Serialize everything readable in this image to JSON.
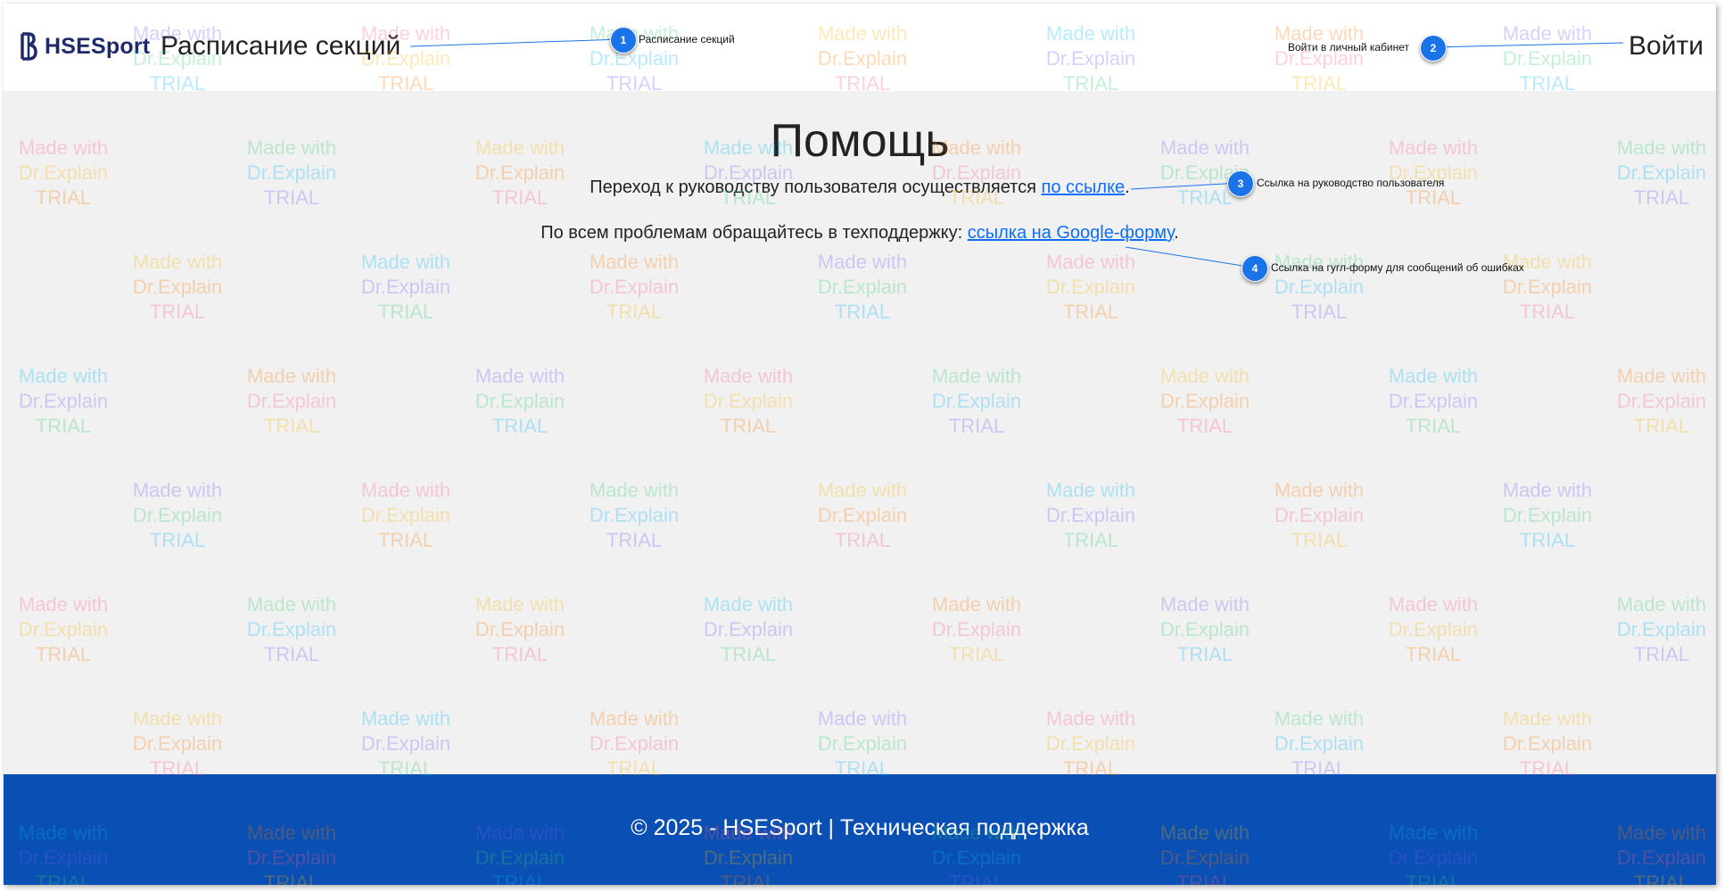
{
  "header": {
    "logo_text": "HSESport",
    "site_title": "Расписание секций",
    "login_label": "Войти"
  },
  "main": {
    "title": "Помощь",
    "guide_text": "Переход к руководству пользователя осуществляется ",
    "guide_link": "по ссылке",
    "guide_end": ".",
    "support_text": "По всем проблемам обращайтесь в техподдержку: ",
    "support_link": "ссылка на Google-форму",
    "support_end": "."
  },
  "footer": {
    "text": "© 2025 - HSESport | Техническая поддержка"
  },
  "callouts": [
    {
      "number": "1",
      "text": "Расписание секций"
    },
    {
      "number": "2",
      "text": "Войти в личный кабинет"
    },
    {
      "number": "3",
      "text": "Ссылка на руководство пользователя"
    },
    {
      "number": "4",
      "text": "Ссылка на гугл-форму для сообщений об ошибках"
    }
  ],
  "watermark": {
    "line1": "Made with",
    "line2": "Dr.Explain",
    "line3": "TRIAL"
  },
  "colors": {
    "footer": "#0a4fb3",
    "link": "#0d6efd",
    "callout": "#1a73e8",
    "logo": "#1f2a6b"
  }
}
